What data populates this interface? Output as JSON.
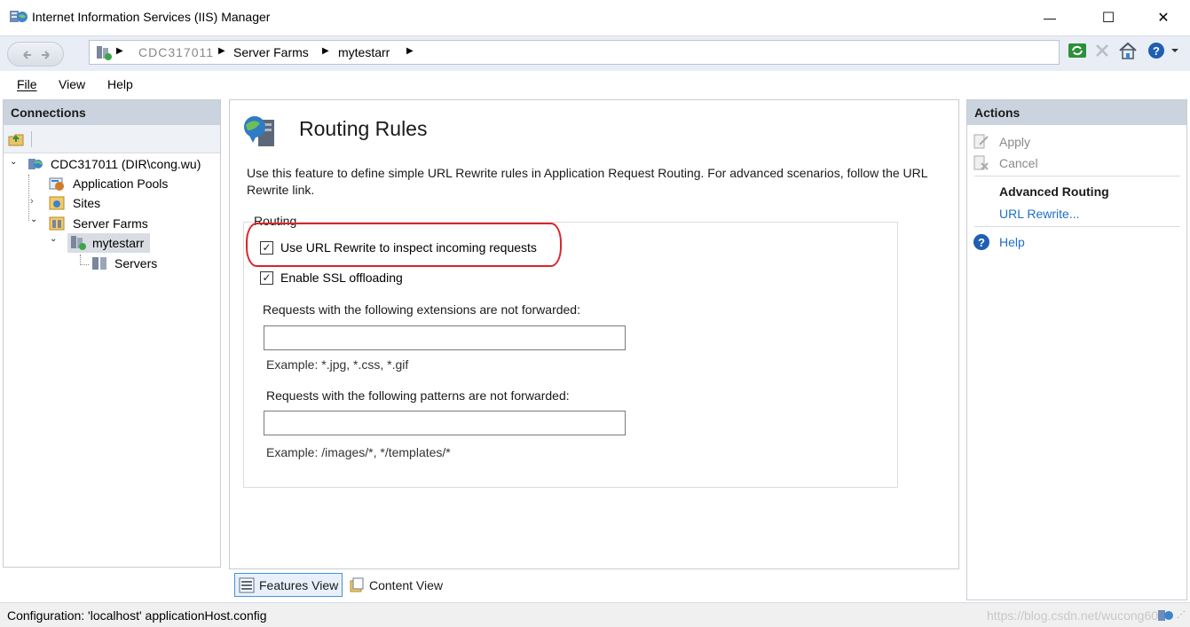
{
  "window": {
    "title": "Internet Information Services (IIS) Manager",
    "minimize_glyph": "—",
    "maximize_glyph": "☐",
    "close_glyph": "✕"
  },
  "address": {
    "crumbs": [
      "CDC317011",
      "Server Farms",
      "mytestarr"
    ]
  },
  "menu": {
    "items": [
      {
        "label": "File"
      },
      {
        "label": "View"
      },
      {
        "label": "Help"
      }
    ]
  },
  "connections": {
    "title": "Connections",
    "tree": {
      "server": "CDC317011 (DIR\\cong.wu)",
      "app_pools": "Application Pools",
      "sites": "Sites",
      "server_farms": "Server Farms",
      "farm": "mytestarr",
      "servers": "Servers"
    }
  },
  "main": {
    "title": "Routing Rules",
    "description": "Use this feature to define simple URL Rewrite rules in Application Request Routing.  For advanced scenarios, follow the URL Rewrite link.",
    "group_label": "Routing",
    "checkbox1": {
      "label": "Use URL Rewrite to inspect incoming requests",
      "checked": true
    },
    "checkbox2": {
      "label": "Enable SSL offloading",
      "checked": true
    },
    "extensions_label": "Requests with the following extensions are not forwarded:",
    "extensions_value": "",
    "extensions_example": "Example: *.jpg, *.css, *.gif",
    "patterns_label": "Requests with the following patterns are not forwarded:",
    "patterns_value": "",
    "patterns_example": "Example: /images/*, */templates/*",
    "highlight_color": "#d9252b"
  },
  "views": {
    "features": "Features View",
    "content": "Content View"
  },
  "actions": {
    "title": "Actions",
    "apply": "Apply",
    "cancel": "Cancel",
    "section": "Advanced Routing",
    "url_rewrite": "URL Rewrite...",
    "help": "Help"
  },
  "status": {
    "text": "Configuration: 'localhost' applicationHost.config",
    "watermark": "https://blog.csdn.net/wucong60"
  },
  "colors": {
    "header_bg": "#cbd3de",
    "link": "#1e6fc6",
    "disabled": "#8a8a8a"
  }
}
